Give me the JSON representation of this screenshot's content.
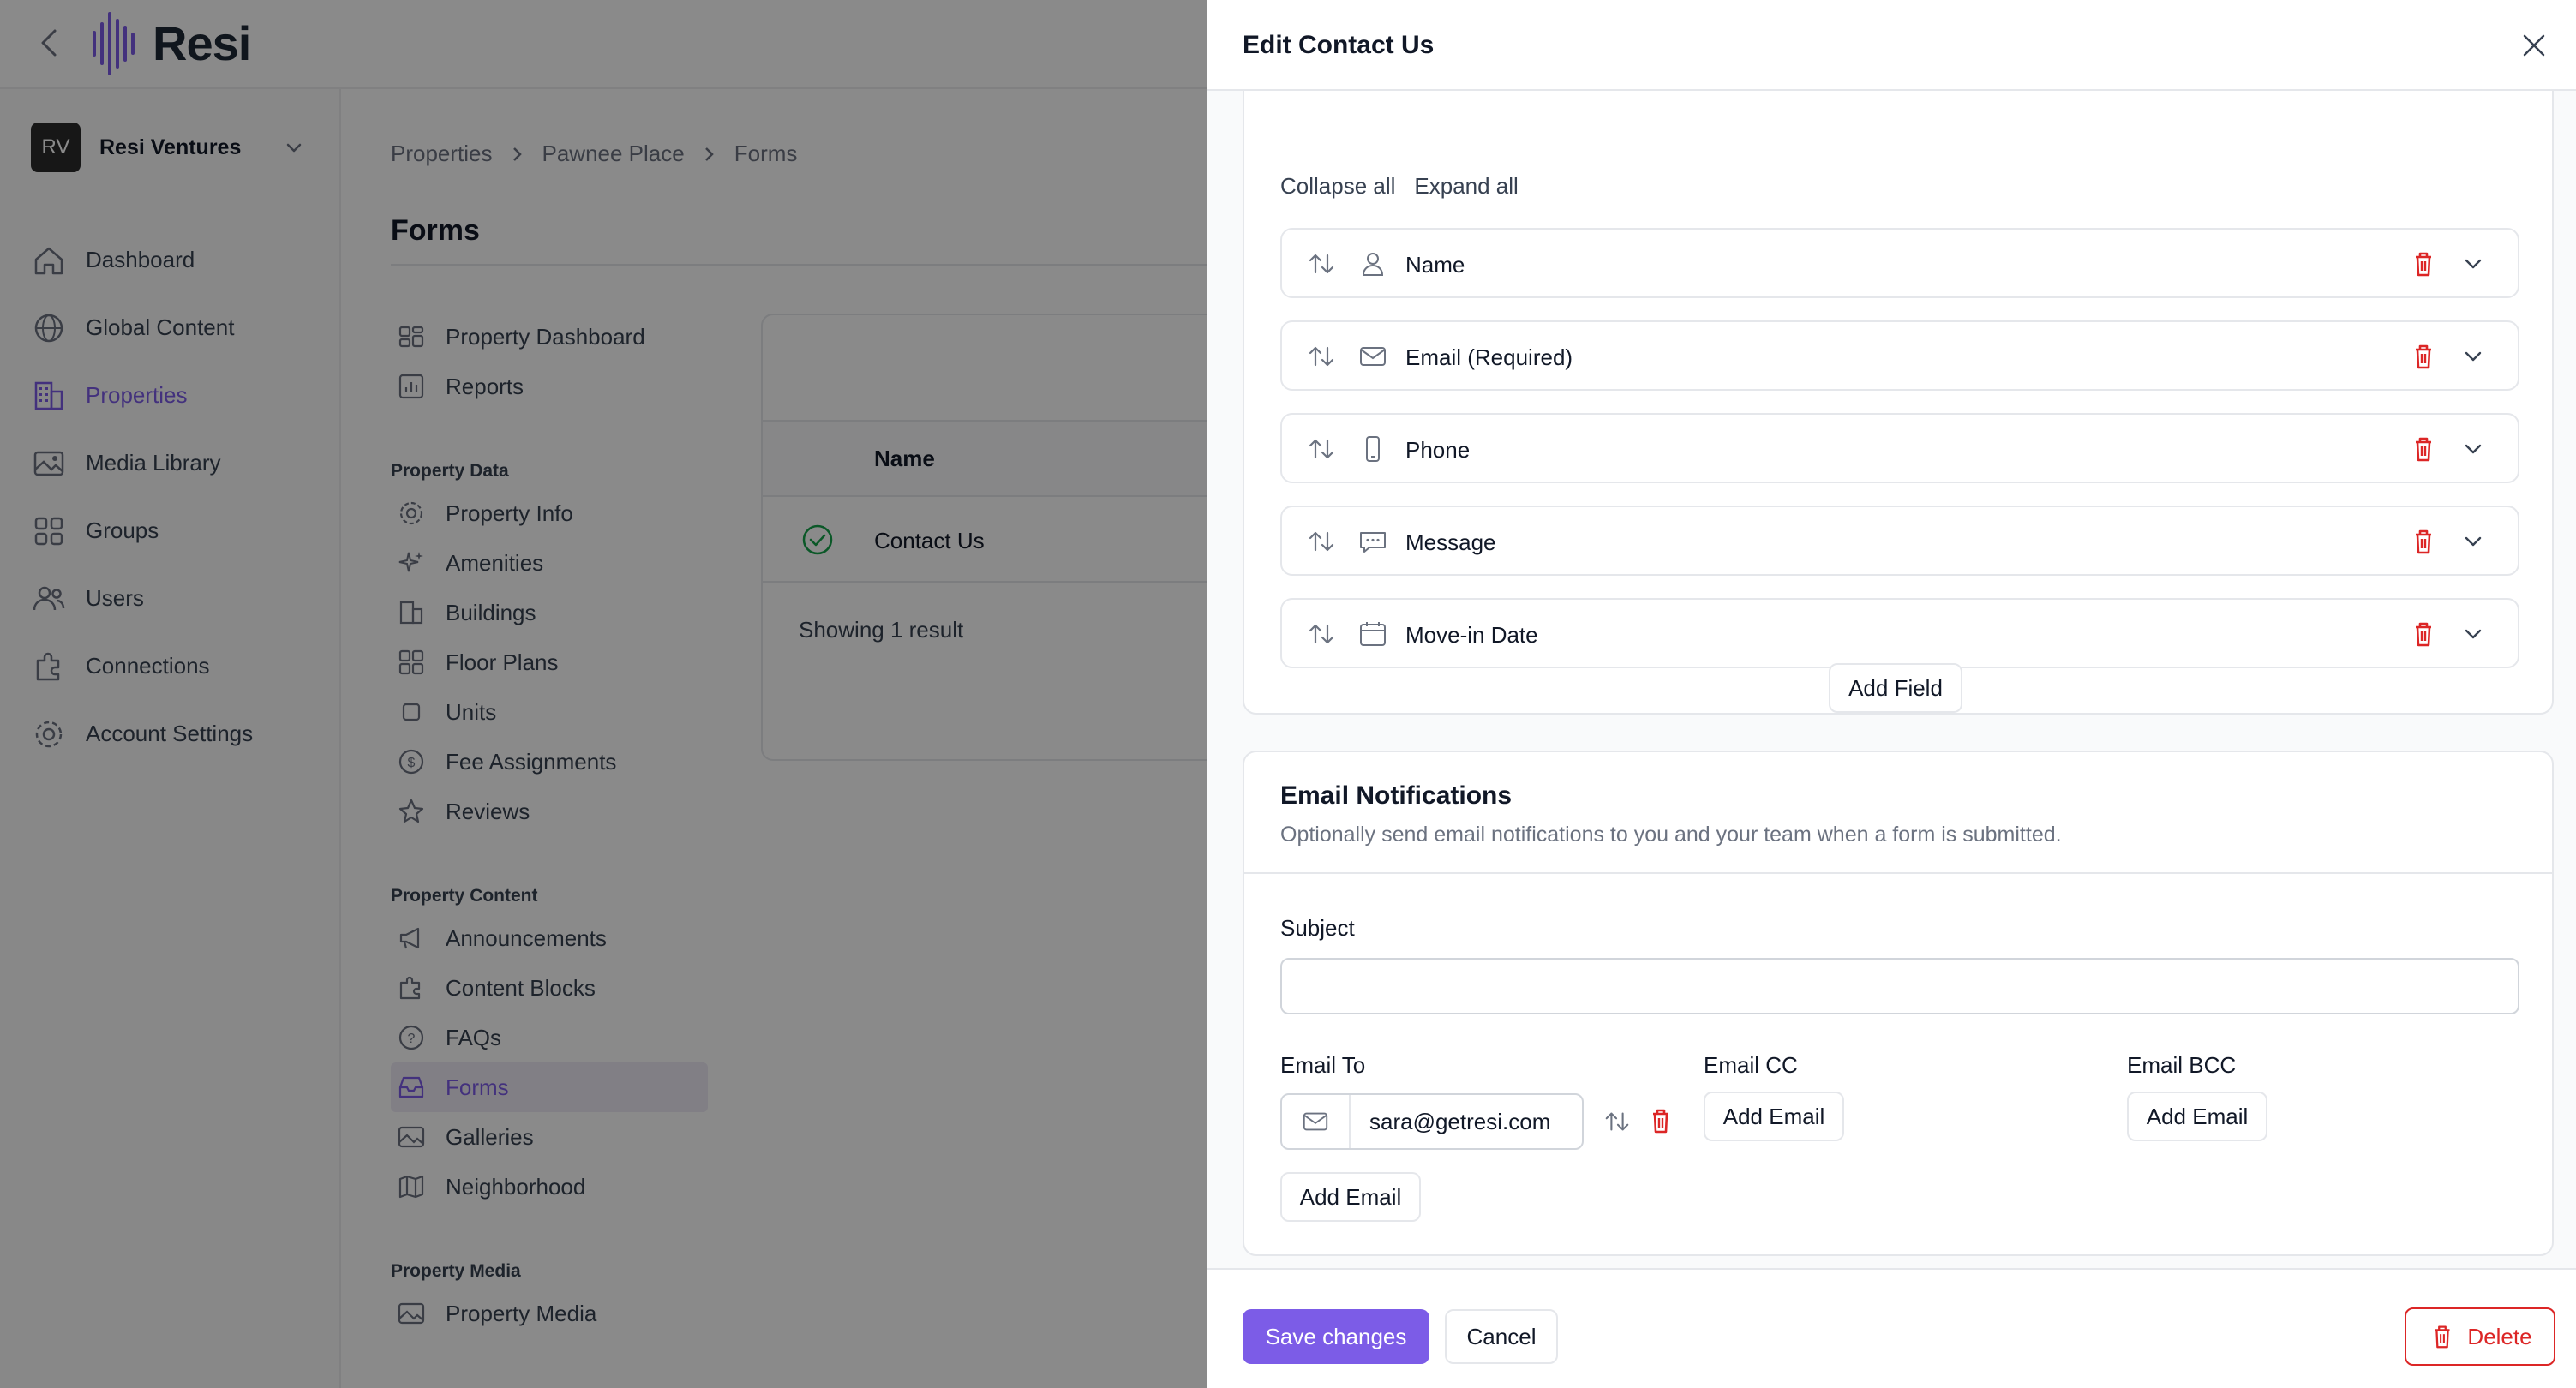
{
  "brand": {
    "name": "Resi"
  },
  "org": {
    "initials": "RV",
    "name": "Resi Ventures"
  },
  "nav": [
    {
      "label": "Dashboard",
      "icon": "home-icon"
    },
    {
      "label": "Global Content",
      "icon": "globe-icon"
    },
    {
      "label": "Properties",
      "icon": "building-icon",
      "active": true
    },
    {
      "label": "Media Library",
      "icon": "image-icon"
    },
    {
      "label": "Groups",
      "icon": "grid-icon"
    },
    {
      "label": "Users",
      "icon": "users-icon"
    },
    {
      "label": "Connections",
      "icon": "puzzle-icon"
    },
    {
      "label": "Account Settings",
      "icon": "gear-icon"
    }
  ],
  "breadcrumb": [
    "Properties",
    "Pawnee Place",
    "Forms"
  ],
  "page": {
    "title": "Forms"
  },
  "subnav": {
    "top": [
      "Property Dashboard",
      "Reports"
    ],
    "property_data_heading": "Property Data",
    "property_data": [
      "Property Info",
      "Amenities",
      "Buildings",
      "Floor Plans",
      "Units",
      "Fee Assignments",
      "Reviews"
    ],
    "property_content_heading": "Property Content",
    "property_content": [
      "Announcements",
      "Content Blocks",
      "FAQs",
      "Forms",
      "Galleries",
      "Neighborhood"
    ],
    "property_media_heading": "Property Media",
    "property_media": [
      "Property Media"
    ]
  },
  "table": {
    "column_name": "Name",
    "row_name": "Contact Us",
    "footer": "Showing 1 result"
  },
  "drawer": {
    "title": "Edit Contact Us",
    "collapse_all": "Collapse all",
    "expand_all": "Expand all",
    "fields": [
      {
        "label": "Name",
        "icon": "user-icon"
      },
      {
        "label": "Email (Required)",
        "icon": "mail-icon"
      },
      {
        "label": "Phone",
        "icon": "phone-icon"
      },
      {
        "label": "Message",
        "icon": "chat-icon"
      },
      {
        "label": "Move-in Date",
        "icon": "calendar-icon"
      }
    ],
    "add_field": "Add Field",
    "notifications": {
      "title": "Email Notifications",
      "description": "Optionally send email notifications to you and your team when a form is submitted.",
      "subject_label": "Subject",
      "subject_value": "",
      "email_to_label": "Email To",
      "email_cc_label": "Email CC",
      "email_bcc_label": "Email BCC",
      "email_to_value": "sara@getresi.com",
      "add_email": "Add Email"
    },
    "save": "Save changes",
    "cancel": "Cancel",
    "delete": "Delete"
  },
  "colors": {
    "accent": "#7c5ce7",
    "danger": "#dc2626",
    "success": "#16a34a"
  }
}
